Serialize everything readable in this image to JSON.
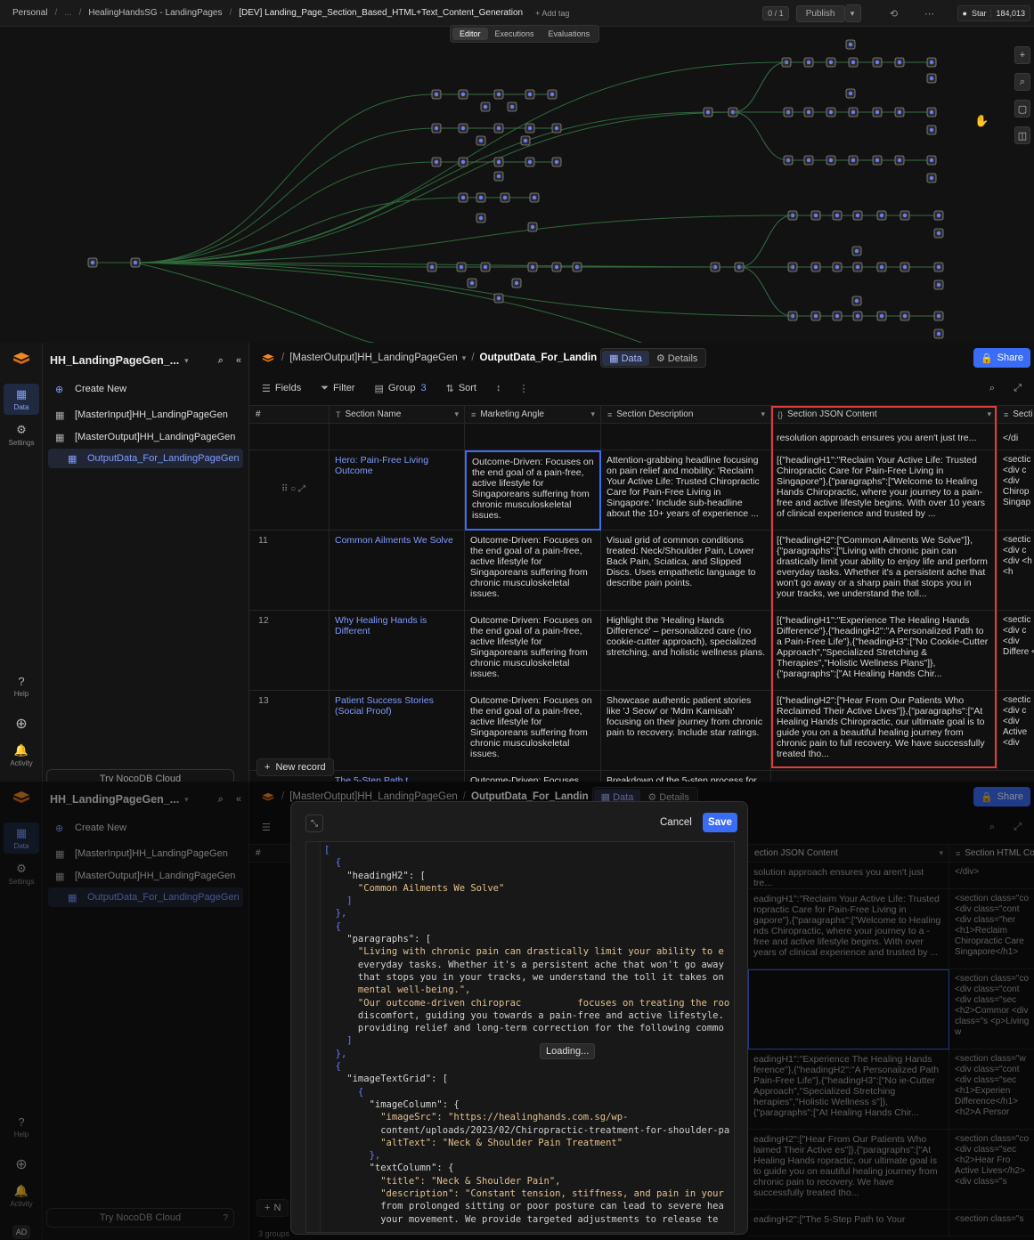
{
  "n8n": {
    "breadcrumb": [
      "Personal",
      "/",
      "...",
      "/",
      "HealingHandsSG - LandingPages",
      "/",
      "[DEV] Landing_Page_Section_Based_HTML+Text_Content_Generation"
    ],
    "add_tag": "+ Add tag",
    "counter": "0 / 1",
    "publish": "Publish",
    "github_star": "Star",
    "github_count": "184,013",
    "tabs": [
      "Editor",
      "Executions",
      "Evaluations"
    ]
  },
  "noco": {
    "base_title": "HH_LandingPageGen_...",
    "create_new": "Create New",
    "tables": [
      "[MasterInput]HH_LandingPageGen",
      "[MasterOutput]HH_LandingPageGen",
      "OutputData_For_LandingPageGen"
    ],
    "rail": {
      "data": "Data",
      "settings": "Settings",
      "help": "Help",
      "activity": "Activity"
    },
    "try_cloud": "Try NocoDB Cloud",
    "avatar": "AD",
    "crumb_base": "[MasterOutput]HH_LandingPageGen",
    "crumb_table": "OutputData_For_Landin",
    "view_tabs": [
      "Data",
      "Details"
    ],
    "share": "Share",
    "toolbar": {
      "fields": "Fields",
      "filter": "Filter",
      "group": "Group",
      "group_count": "3",
      "sort": "Sort"
    },
    "columns": [
      "#",
      "Section Name",
      "Marketing Angle",
      "Section Description",
      "Section JSON Content",
      "Secti"
    ],
    "columns2": [
      "ection JSON Content",
      "Section HTML Co"
    ],
    "top_partial": {
      "json": "resolution approach ensures you aren't just tre...",
      "html": "</di"
    },
    "rows": [
      {
        "num": "",
        "name": "Hero: Pain-Free Living Outcome",
        "angle": "Outcome-Driven: Focuses on the end goal of a pain-free, active lifestyle for Singaporeans suffering from chronic musculoskeletal issues.",
        "desc": "Attention-grabbing headline focusing on pain relief and mobility: 'Reclaim Your Active Life: Trusted Chiropractic Care for Pain-Free Living in Singapore.' Include sub-headline about the 10+ years of experience ...",
        "json": "[{\"headingH1\":\"Reclaim Your Active Life: Trusted Chiropractic Care for Pain-Free Living in Singapore\"},{\"paragraphs\":[\"Welcome to Healing Hands Chiropractic, where your journey to a pain-free and active lifestyle begins. With over 10 years of clinical experience and trusted by ...",
        "html": "<sectic <div c <div Chirop Singap"
      },
      {
        "num": "11",
        "name": "Common Ailments We Solve",
        "angle": "Outcome-Driven: Focuses on the end goal of a pain-free, active lifestyle for Singaporeans suffering from chronic musculoskeletal issues.",
        "desc": "Visual grid of common conditions treated: Neck/Shoulder Pain, Lower Back Pain, Sciatica, and Slipped Discs. Uses empathetic language to describe pain points.",
        "json": "[{\"headingH2\":[\"Common Ailments We Solve\"]},{\"paragraphs\":[\"Living with chronic pain can drastically limit your ability to enjoy life and perform everyday tasks. Whether it's a persistent ache that won't go away or a sharp pain that stops you in your tracks, we understand the toll...",
        "html": "<sectic <div c <div <h <d <h"
      },
      {
        "num": "12",
        "name": "Why Healing Hands is Different",
        "angle": "Outcome-Driven: Focuses on the end goal of a pain-free, active lifestyle for Singaporeans suffering from chronic musculoskeletal issues.",
        "desc": "Highlight the 'Healing Hands Difference' – personalized care (no cookie-cutter approach), specialized stretching, and holistic wellness plans.",
        "json": "[{\"headingH1\":\"Experience The Healing Hands Difference\"},{\"headingH2\":\"A Personalized Path to a Pain-Free Life\"},{\"headingH3\":[\"No Cookie-Cutter Approach\",\"Specialized Stretching & Therapies\",\"Holistic Wellness Plans\"]},{\"paragraphs\":[\"At Healing Hands Chir...",
        "html": "<sectic <div c <div Differe <h"
      },
      {
        "num": "13",
        "name": "Patient Success Stories (Social Proof)",
        "angle": "Outcome-Driven: Focuses on the end goal of a pain-free, active lifestyle for Singaporeans suffering from chronic musculoskeletal issues.",
        "desc": "Showcase authentic patient stories like 'J Seow' or 'Mdm Kamisah' focusing on their journey from chronic pain to recovery. Include star ratings.",
        "json": "[{\"headingH2\":[\"Hear From Our Patients Who Reclaimed Their Active Lives\"]},{\"paragraphs\":[\"At Healing Hands Chiropractic, our ultimate goal is to guide you on a beautiful healing journey from chronic pain to full recovery. We have successfully treated tho...",
        "html": "<sectic <div c <div Active <div"
      }
    ],
    "bottom_partial": {
      "name": "The 5-Step Path t",
      "angle": "Outcome-Driven: Focuses",
      "desc": "Breakdown of the 5-step process for"
    },
    "new_record": "New record"
  },
  "second_panel": {
    "json_col": [
      "solution approach ensures you aren't just tre...",
      "eadingH1\":\"Reclaim Your Active Life: Trusted ropractic Care for Pain-Free Living in gapore\"},{\"paragraphs\":[\"Welcome to Healing nds Chiropractic, where your journey to a -free and active lifestyle begins. With over years of clinical experience and trusted by ...",
      "",
      "eadingH1\":\"Experience The Healing Hands ference\"},{\"headingH2\":\"A Personalized Path Pain-Free Life\"},{\"headingH3\":[\"No ie-Cutter Approach\",\"Specialized Stretching herapies\",\"Holistic Wellness s\"]},{\"paragraphs\":[\"At Healing Hands Chir...",
      "eadingH2\":[\"Hear From Our Patients Who laimed Their Active es\"]},{\"paragraphs\":[\"At Healing Hands ropractic, our ultimate goal is to guide you on eautiful healing journey from chronic pain to recovery. We have successfully treated tho...",
      "eadingH2\":[\"The 5-Step Path to Your"
    ],
    "html_col": [
      "</div>",
      "<section class=\"co <div class=\"cont <div class=\"her <h1>Reclaim Chiropractic Care Singapore</h1>",
      "<section class=\"co <div class=\"cont <div class=\"sec <h2>Commor <div class=\"s <p>Living w",
      "<section class=\"w <div class=\"cont <div class=\"sec <h1>Experien Difference</h1> <h2>A Persor",
      "<section class=\"co <div class=\"sec <h2>Hear Fro Active Lives</h2> <div class=\"s",
      "<section class=\"s"
    ],
    "footer_left": "3 groups",
    "new_short": "N"
  },
  "modal": {
    "cancel": "Cancel",
    "save": "Save",
    "loading": "Loading...",
    "code_lines": [
      "[",
      "  {",
      "    \"headingH2\": [",
      "      \"Common Ailments We Solve\"",
      "    ]",
      "  },",
      "  {",
      "    \"paragraphs\": [",
      "      \"Living with chronic pain can drastically limit your ability to e",
      "      everyday tasks. Whether it's a persistent ache that won't go away",
      "      that stops you in your tracks, we understand the toll it takes on",
      "      mental well-being.\",",
      "      \"Our outcome-driven chiroprac          focuses on treating the roo",
      "      discomfort, guiding you towards a pain-free and active lifestyle.",
      "      providing relief and long-term correction for the following commo",
      "    ]",
      "  },",
      "  {",
      "    \"imageTextGrid\": [",
      "      {",
      "        \"imageColumn\": {",
      "          \"imageSrc\": \"https://healinghands.com.sg/wp-",
      "          content/uploads/2023/02/Chiropractic-treatment-for-shoulder-pa",
      "          \"altText\": \"Neck & Shoulder Pain Treatment\"",
      "        },",
      "        \"textColumn\": {",
      "          \"title\": \"Neck & Shoulder Pain\",",
      "          \"description\": \"Constant tension, stiffness, and pain in your",
      "          from prolonged sitting or poor posture can lead to severe hea",
      "          your movement. We provide targeted adjustments to release te"
    ]
  },
  "colors": {
    "accent": "#3b6cf6",
    "highlight": "#e23b3b",
    "link": "#7f9bff",
    "logo": "#f08a24"
  }
}
